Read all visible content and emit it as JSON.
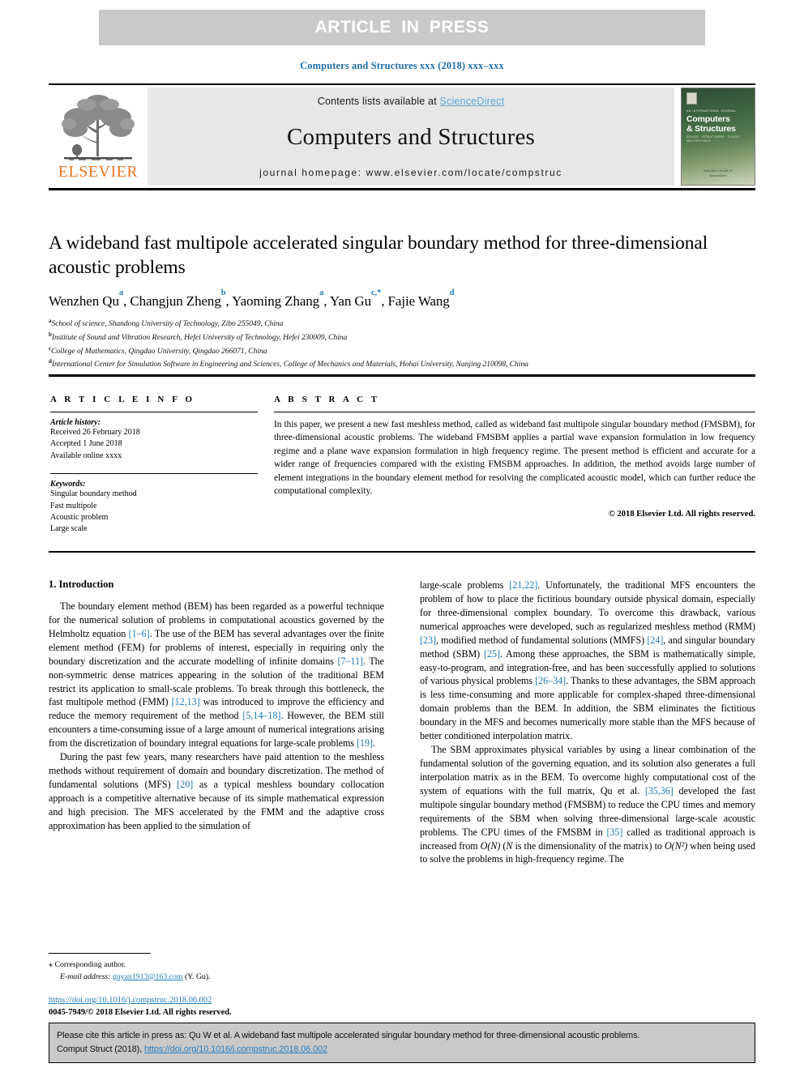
{
  "banner": {
    "text": "ARTICLE  IN  PRESS"
  },
  "running_head": "Computers and Structures xxx (2018) xxx–xxx",
  "masthead": {
    "publisher_name": "ELSEVIER",
    "contents_prefix": "Contents lists available at ",
    "sciencedirect": "ScienceDirect",
    "journal_title": "Computers and Structures",
    "homepage": "journal homepage: www.elsevier.com/locate/compstruc",
    "cover": {
      "kicker": "AN INTERNATIONAL JOURNAL",
      "title_line1": "Computers",
      "title_line2": "& Structures",
      "subtitle": "SOLIDS · STRUCTURES · FLUIDS · MULTIPHYSICS",
      "footer_line1": "AVAILABLE ONLINE AT",
      "footer_line2": "ScienceDirect"
    }
  },
  "article": {
    "title": "A wideband fast multipole accelerated singular boundary method for three-dimensional acoustic problems",
    "authors": [
      {
        "name": "Wenzhen Qu",
        "sup": "a",
        "sep": ", "
      },
      {
        "name": "Changjun Zheng",
        "sup": "b",
        "sep": ", "
      },
      {
        "name": "Yaoming Zhang",
        "sup": "a",
        "sep": ", "
      },
      {
        "name": "Yan Gu",
        "sup": "c,*",
        "sep": ", "
      },
      {
        "name": "Fajie Wang",
        "sup": "d",
        "sep": ""
      }
    ],
    "affiliations": [
      {
        "marker": "a",
        "text": "School of science, Shandong University of Technology, Zibo 255049, China"
      },
      {
        "marker": "b",
        "text": "Institute of Sound and Vibration Research, Hefei University of Technology, Hefei 230009, China"
      },
      {
        "marker": "c",
        "text": "College of Mathematics, Qingdao University, Qingdao 266071, China"
      },
      {
        "marker": "d",
        "text": "International Center for Simulation Software in Engineering and Sciences, College of Mechanics and Materials, Hohai University, Nanjing 210098, China"
      }
    ]
  },
  "article_info": {
    "heading": "A R T I C L E   I N F O",
    "history_label": "Article history:",
    "history": [
      "Received 26 February 2018",
      "Accepted 1 June 2018",
      "Available online xxxx"
    ],
    "keywords_label": "Keywords:",
    "keywords": [
      "Singular boundary method",
      "Fast multipole",
      "Acoustic problem",
      "Large scale"
    ]
  },
  "abstract": {
    "heading": "A B S T R A C T",
    "text": "In this paper, we present a new fast meshless method, called as wideband fast multipole singular boundary method (FMSBM), for three-dimensional acoustic problems. The wideband FMSBM applies a partial wave expansion formulation in low frequency regime and a plane wave expansion formulation in high frequency regime. The present method is efficient and accurate for a wider range of frequencies compared with the existing FMSBM approaches. In addition, the method avoids large number of element integrations in the boundary element method for resolving the complicated acoustic model, which can further reduce the computational complexity.",
    "copyright": "© 2018 Elsevier Ltd. All rights reserved."
  },
  "body": {
    "section_title": "1. Introduction",
    "left_paragraphs": [
      {
        "parts": [
          {
            "t": "The boundary element method (BEM) has been regarded as a powerful technique for the numerical solution of problems in computational acoustics governed by the Helmholtz equation "
          },
          {
            "t": "[1–6]",
            "style": "ref"
          },
          {
            "t": ". The use of the BEM has several advantages over the finite element method (FEM) for problems of interest, especially in requiring only the boundary discretization and the accurate modelling of infinite domains "
          },
          {
            "t": "[7–11]",
            "style": "ref"
          },
          {
            "t": ". The non-symmetric dense matrices appearing in the solution of the traditional BEM restrict its application to small-scale problems. To break through this bottleneck, the fast multipole method (FMM) "
          },
          {
            "t": "[12,13]",
            "style": "ref"
          },
          {
            "t": " was introduced to improve the efficiency and reduce the memory requirement of the method "
          },
          {
            "t": "[5,14–18]",
            "style": "ref"
          },
          {
            "t": ". However, the BEM still encounters a time-consuming issue of a large amount of numerical integrations arising from the discretization of boundary integral equations for large-scale problems "
          },
          {
            "t": "[19]",
            "style": "ref"
          },
          {
            "t": "."
          }
        ]
      },
      {
        "parts": [
          {
            "t": "During the past few years, many researchers have paid attention to the meshless methods without requirement of domain and boundary discretization. The method of fundamental solutions (MFS) "
          },
          {
            "t": "[20]",
            "style": "ref"
          },
          {
            "t": " as a typical meshless boundary collocation approach is a competitive alternative because of its simple mathematical expression and high precision. The MFS accelerated by the FMM and the adaptive cross approximation has been applied to the simulation of"
          }
        ]
      }
    ],
    "right_paragraphs": [
      {
        "parts": [
          {
            "t": "large-scale problems "
          },
          {
            "t": "[21,22]",
            "style": "ref"
          },
          {
            "t": ". Unfortunately, the traditional MFS encounters the problem of how to place the fictitious boundary outside physical domain, especially for three-dimensional complex boundary. To overcome this drawback, various numerical approaches were developed, such as regularized meshless method (RMM) "
          },
          {
            "t": "[23]",
            "style": "ref"
          },
          {
            "t": ", modified method of fundamental solutions (MMFS) "
          },
          {
            "t": "[24]",
            "style": "ref"
          },
          {
            "t": ", and singular boundary method (SBM) "
          },
          {
            "t": "[25]",
            "style": "ref"
          },
          {
            "t": ". Among these approaches, the SBM is mathematically simple, easy-to-program, and integration-free, and has been successfully applied to solutions of various physical problems "
          },
          {
            "t": "[26–34]",
            "style": "ref"
          },
          {
            "t": ". Thanks to these advantages, the SBM approach is less time-consuming and more applicable for complex-shaped three-dimensional domain problems than the BEM. In addition, the SBM eliminates the fictitious boundary in the MFS and becomes numerically more stable than the MFS because of better conditioned interpolation matrix."
          }
        ],
        "indent": false
      },
      {
        "parts": [
          {
            "t": "The SBM approximates physical variables by using a linear combination of the fundamental solution of the governing equation, and its solution also generates a full interpolation matrix as in the BEM. To overcome highly computational cost of the system of equations with the full matrix, Qu et al. "
          },
          {
            "t": "[35,36]",
            "style": "ref"
          },
          {
            "t": " developed the fast multipole singular boundary method (FMSBM) to reduce the CPU times and memory requirements of the SBM when solving three-dimensional large-scale acoustic problems. The CPU times of the FMSBM in "
          },
          {
            "t": "[35]",
            "style": "ref"
          },
          {
            "t": " called as traditional approach is increased from "
          },
          {
            "t": "O(N)",
            "style": "ital"
          },
          {
            "t": " ("
          },
          {
            "t": "N",
            "style": "ital"
          },
          {
            "t": " is the dimensionality of the matrix) to "
          },
          {
            "t": "O(N²)",
            "style": "ital"
          },
          {
            "t": " when being used to solve the problems in high-frequency regime. The"
          }
        ],
        "indent": true
      }
    ]
  },
  "footnote": {
    "corresponding_marker": "⁎",
    "corresponding_text": "Corresponding author.",
    "email_label": "E-mail address:",
    "email": "guyan1913@163.com",
    "email_suffix": " (Y. Gu)."
  },
  "doi_block": {
    "doi_url": "https://doi.org/10.1016/j.compstruc.2018.06.002",
    "issn_line": "0045-7949/© 2018 Elsevier Ltd. All rights reserved."
  },
  "cite_box": {
    "line1": "Please cite this article in press as: Qu W et al. A wideband fast multipole accelerated singular boundary method for three-dimensional acoustic problems.",
    "line2_prefix": "Comput Struct (2018), ",
    "line2_link": "https://doi.org/10.1016/j.compstruc.2018.06.002"
  },
  "colors": {
    "link_blue": "#1f7bb6",
    "sciencedirect_blue": "#5aa7d8",
    "elsevier_orange": "#e87722",
    "band_gray": "#c9c9c9",
    "masthead_gray": "#e7e7e7"
  }
}
